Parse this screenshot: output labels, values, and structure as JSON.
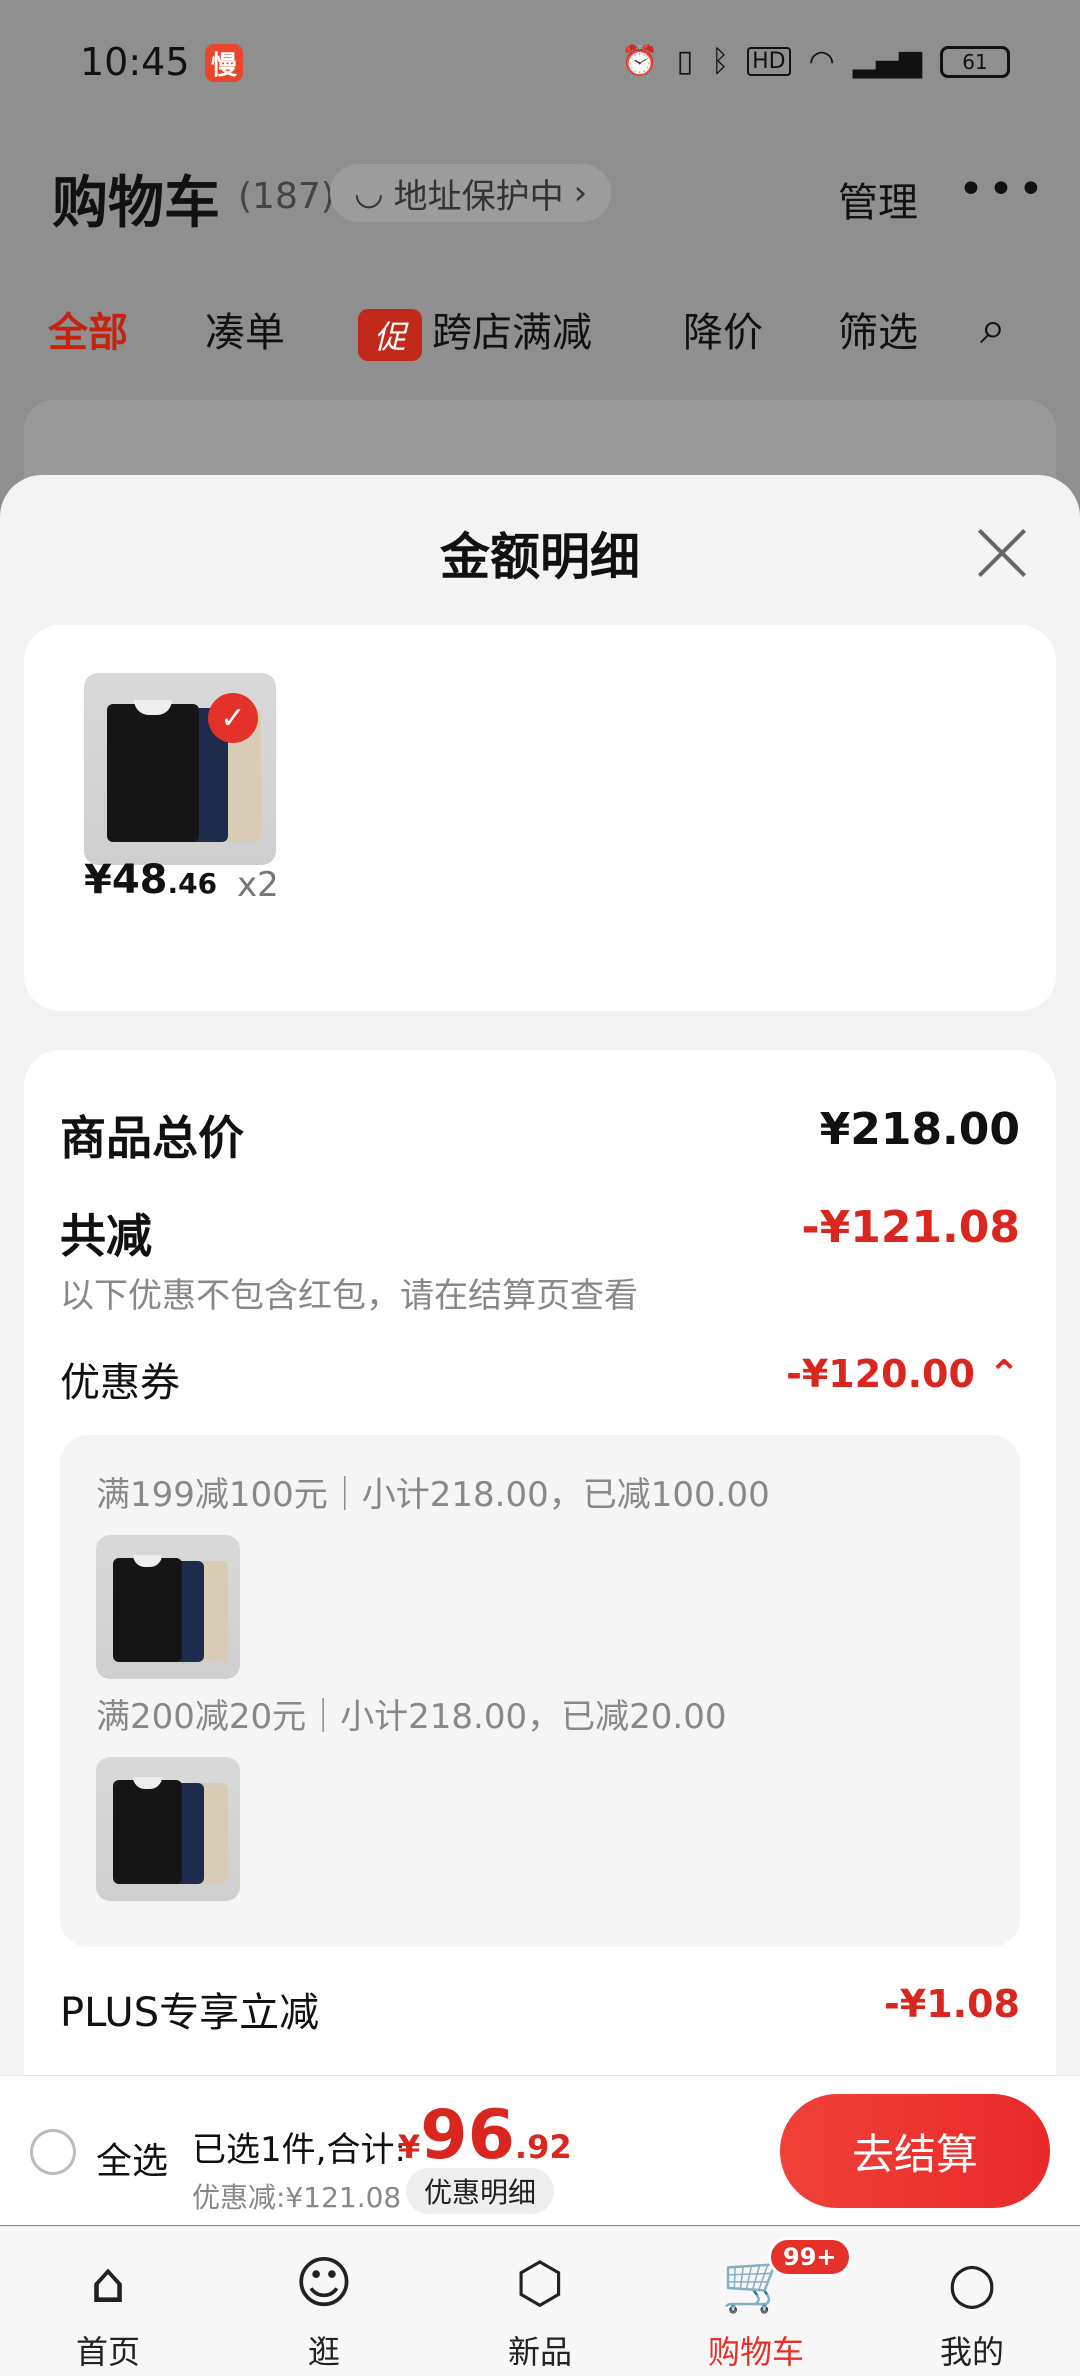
{
  "status_bar": {
    "time": "10:45",
    "app_badge_text": "慢",
    "battery": "61",
    "icons": [
      "alarm-icon",
      "vibrate-icon",
      "bluetooth-icon",
      "hd-icon",
      "wifi-icon",
      "signal-5g-icon"
    ]
  },
  "cart_header": {
    "title": "购物车",
    "count": "(187)",
    "address_label": "地址保护中",
    "manage_label": "管理",
    "more_label": "•••"
  },
  "cart_tabs": [
    {
      "label": "全部"
    },
    {
      "label": "凑单"
    },
    {
      "label": "跨店满减",
      "tag": "促"
    },
    {
      "label": "降价"
    },
    {
      "label": "筛选"
    }
  ],
  "sheet": {
    "title": "金额明细",
    "product": {
      "price_int": "¥48",
      "price_dec": ".46",
      "quantity": "x2"
    },
    "rows": {
      "subtotal_label": "商品总价",
      "subtotal_value": "¥218.00",
      "discount_label": "共减",
      "discount_value": "-¥121.08",
      "discount_note": "以下优惠不包含红包，请在结算页查看",
      "coupon_label": "优惠券",
      "coupon_value": "-¥120.00 ⌃",
      "coupon_lines": [
        "满199减100元｜小计218.00，已减100.00",
        "满200减20元｜小计218.00，已减20.00"
      ],
      "plus_label": "PLUS专享立减",
      "plus_value": "-¥1.08"
    }
  },
  "checkout": {
    "select_all": "全选",
    "selected_text": "已选1件,合计:",
    "total_yen": "¥",
    "total_int": "96",
    "total_dec": ".92",
    "discount_text": "优惠减:¥121.08",
    "discount_detail": "优惠明细",
    "button": "去结算"
  },
  "tabbar": {
    "items": [
      {
        "label": "首页",
        "icon": "home-icon"
      },
      {
        "label": "逛",
        "icon": "explore-icon"
      },
      {
        "label": "新品",
        "icon": "cube-icon"
      },
      {
        "label": "购物车",
        "icon": "cart-icon"
      },
      {
        "label": "我的",
        "icon": "user-icon"
      }
    ],
    "cart_badge": "99+"
  },
  "colors": {
    "accent": "#e4312a",
    "sheet_bg": "#f3f3f3"
  }
}
